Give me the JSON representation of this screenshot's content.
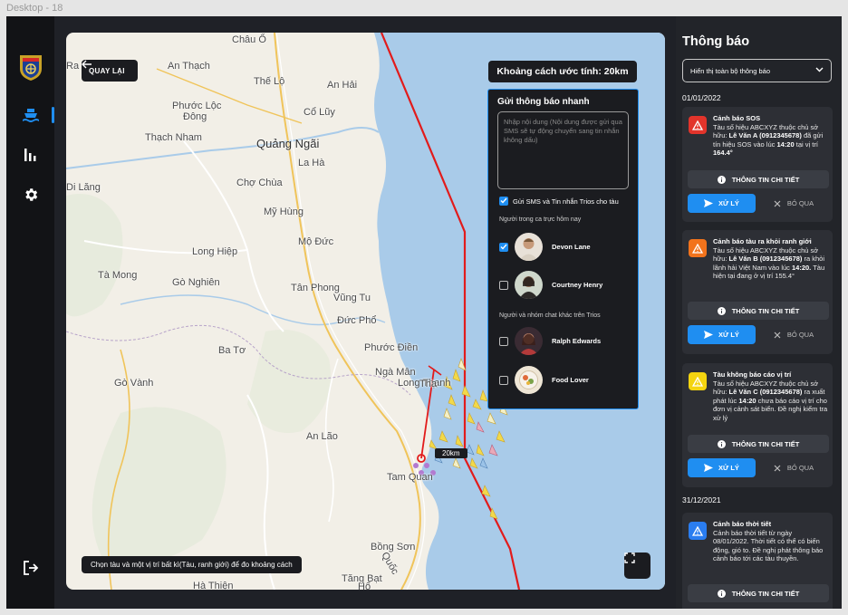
{
  "frame_label": "Desktop - 18",
  "colors": {
    "accent": "#1f8ef1",
    "danger": "#e2342b",
    "warning": "#f2731c",
    "caution": "#f4d40f",
    "info": "#2a7df0",
    "boundary": "#e21b1b"
  },
  "sidebar": {
    "items": [
      {
        "name": "ship-icon",
        "active": true
      },
      {
        "name": "stats-icon",
        "active": false
      },
      {
        "name": "settings-icon",
        "active": false
      }
    ],
    "logout": "logout-icon"
  },
  "map": {
    "back_label": "QUAY LẠI",
    "distance_label": "Khoảng cách ước tính: 20km",
    "distance_tag": "20km",
    "hint": "Chọn tàu và một vị trí bất kì(Tàu, ranh giới) để đo khoảng cách",
    "places": [
      "Châu Ổ",
      "Thế Lộ",
      "An Thạch",
      "An Hải",
      "Phước Lộc",
      "Đông",
      "Cổ Lũy",
      "Thạch Nham",
      "Quảng Ngãi",
      "La Hà",
      "Chợ Chùa",
      "Di Lăng",
      "Mỹ Hùng",
      "Mộ Đức",
      "Long Hiệp",
      "Tà Mong",
      "Gò Nghiên",
      "Tân Phong",
      "Vũng Tu",
      "Đức Phổ",
      "Phước Điền",
      "Ba Tơ",
      "Ngà Mân",
      "Long Thạnh",
      "Gò Vành",
      "An Lão",
      "Tam Quan",
      "Bồng Sơn",
      "Tăng Bạt",
      "Hà Thiện",
      "Hổ",
      "Quốc",
      "Thạ",
      "Ra Lạc"
    ]
  },
  "quick_notify": {
    "title": "Gửi thông báo nhanh",
    "placeholder": "Nhập nội dung (Nội dung được gửi qua SMS sẽ tự động chuyển sang tin nhắn không dấu)",
    "sms_label": "Gửi SMS và Tin nhắn Trios cho tàu",
    "sms_checked": true,
    "section_on_duty": "Người trong ca trực hôm nay",
    "section_others": "Người và nhóm chat khác trên Trios",
    "on_duty": [
      {
        "name": "Devon Lane",
        "checked": true
      },
      {
        "name": "Courtney Henry",
        "checked": false
      }
    ],
    "others": [
      {
        "name": "Ralph Edwards",
        "checked": false
      },
      {
        "name": "Food Lover",
        "checked": false
      }
    ]
  },
  "notifications": {
    "title": "Thông báo",
    "filter": "Hiển thị toàn bộ thông báo",
    "detail_label": "THÔNG TIN CHI TIẾT",
    "handle_label": "XỬ LÝ",
    "skip_label": "BỎ QUA",
    "dates": [
      "01/01/2022",
      "31/12/2021"
    ],
    "cards": [
      {
        "title": "Cảnh báo SOS",
        "body_1": "Tàu số hiệu ABCXYZ thuộc chủ sở hữu: ",
        "owner": "Lê Văn A (0912345678)",
        "body_2": " đã gửi tín hiệu SOS vào lúc ",
        "time": "14:20",
        "body_3": " tại vị trí ",
        "pos": "164.4°",
        "icon": "alert-triangle-icon",
        "level": "danger"
      },
      {
        "title": "Cảnh báo tàu ra khỏi ranh giới",
        "body_1": "Tàu số hiệu ABCXYZ thuộc chủ sở hữu: ",
        "owner": "Lê Văn B (0912345678)",
        "body_2": " ra khỏi lãnh hải Việt Nam vào lúc ",
        "time": "14:20.",
        "body_3": " Tàu hiện tại đang ở vị trí 155.4°",
        "icon": "alert-triangle-icon",
        "level": "warning"
      },
      {
        "title": "Tàu không báo cáo vị trí",
        "body_1": "Tàu số hiệu ABCXYZ thuộc chủ sở hữu: ",
        "owner": "Lê Văn C (0912345678)",
        "body_2": " ra xuất phát lúc ",
        "time": "14:20",
        "body_3": " chưa báo cáo vị trí cho đơn vị cảnh sát biển. Đề nghị kiểm tra xử lý",
        "icon": "alert-triangle-icon",
        "level": "caution"
      },
      {
        "title": "Cảnh báo thời tiết",
        "body_1": "Cảnh báo thời tiết từ ngày 08/01/2022. Thời tiết có thể có biến động, gió to. Đề nghị phát thông báo cảnh báo tới các tàu thuyền.",
        "icon": "alert-triangle-icon",
        "level": "info"
      }
    ]
  }
}
